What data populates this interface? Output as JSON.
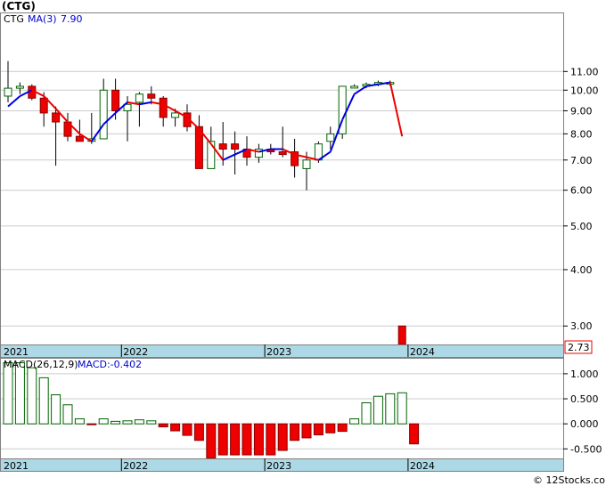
{
  "title": "(CTG)",
  "price_legend": {
    "ticker": "CTG",
    "ma_label": "MA(3)",
    "ma_value": "7.90"
  },
  "macd_legend": {
    "label": "MACD(26,12,9)",
    "value_label": "MACD:-0.402"
  },
  "last_price_label": "2.73",
  "watermark": "© 12Stocks.com",
  "colors": {
    "up_fill": "#ffffff",
    "up_stroke": "#006400",
    "down_fill": "#ee0000",
    "down_stroke": "#880000",
    "ma_up": "#0000dd",
    "ma_down": "#ee0000",
    "axis_band": "#add8e6",
    "grid": "#cccccc"
  },
  "chart_data": [
    {
      "type": "candlestick",
      "scale": "log",
      "ylim": [
        2.73,
        14.8
      ],
      "y_ticks": [
        "3.00",
        "4.00",
        "5.00",
        "6.00",
        "7.00",
        "8.00",
        "9.00",
        "10.00",
        "11.00"
      ],
      "x_labels": [
        {
          "label": "2021",
          "index": 0
        },
        {
          "label": "2022",
          "index": 9.5
        },
        {
          "label": "2023",
          "index": 21.5
        },
        {
          "label": "2024",
          "index": 33.5
        }
      ],
      "candles": [
        {
          "o": 9.7,
          "h": 11.6,
          "l": 9.4,
          "c": 10.1
        },
        {
          "o": 10.1,
          "h": 10.4,
          "l": 9.8,
          "c": 10.2
        },
        {
          "o": 10.2,
          "h": 10.3,
          "l": 9.5,
          "c": 9.6
        },
        {
          "o": 9.6,
          "h": 9.9,
          "l": 8.3,
          "c": 8.9
        },
        {
          "o": 8.9,
          "h": 9.2,
          "l": 6.8,
          "c": 8.5
        },
        {
          "o": 8.5,
          "h": 8.9,
          "l": 7.7,
          "c": 7.9
        },
        {
          "o": 7.9,
          "h": 8.6,
          "l": 7.7,
          "c": 7.7
        },
        {
          "o": 7.7,
          "h": 8.9,
          "l": 7.6,
          "c": 7.8
        },
        {
          "o": 7.8,
          "h": 10.6,
          "l": 7.8,
          "c": 10.0
        },
        {
          "o": 10.0,
          "h": 10.6,
          "l": 8.6,
          "c": 9.0
        },
        {
          "o": 9.0,
          "h": 9.7,
          "l": 7.7,
          "c": 9.3
        },
        {
          "o": 9.4,
          "h": 9.9,
          "l": 8.3,
          "c": 9.8
        },
        {
          "o": 9.8,
          "h": 10.2,
          "l": 9.3,
          "c": 9.6
        },
        {
          "o": 9.6,
          "h": 9.7,
          "l": 8.3,
          "c": 8.7
        },
        {
          "o": 8.7,
          "h": 9.1,
          "l": 8.3,
          "c": 8.9
        },
        {
          "o": 8.9,
          "h": 9.3,
          "l": 8.1,
          "c": 8.3
        },
        {
          "o": 8.3,
          "h": 8.8,
          "l": 7.5,
          "c": 6.7
        },
        {
          "o": 6.7,
          "h": 8.3,
          "l": 6.7,
          "c": 7.7
        },
        {
          "o": 7.6,
          "h": 8.5,
          "l": 6.8,
          "c": 7.4
        },
        {
          "o": 7.6,
          "h": 8.1,
          "l": 6.5,
          "c": 7.4
        },
        {
          "o": 7.4,
          "h": 7.9,
          "l": 6.8,
          "c": 7.1
        },
        {
          "o": 7.1,
          "h": 7.6,
          "l": 6.9,
          "c": 7.4
        },
        {
          "o": 7.4,
          "h": 7.6,
          "l": 7.2,
          "c": 7.3
        },
        {
          "o": 7.3,
          "h": 8.3,
          "l": 7.1,
          "c": 7.2
        },
        {
          "o": 7.3,
          "h": 7.8,
          "l": 6.4,
          "c": 6.8
        },
        {
          "o": 6.7,
          "h": 7.3,
          "l": 6.0,
          "c": 7.0
        },
        {
          "o": 7.0,
          "h": 7.7,
          "l": 6.9,
          "c": 7.6
        },
        {
          "o": 7.7,
          "h": 8.3,
          "l": 7.4,
          "c": 8.0
        },
        {
          "o": 8.0,
          "h": 10.2,
          "l": 7.8,
          "c": 10.2
        },
        {
          "o": 10.2,
          "h": 10.3,
          "l": 10.1,
          "c": 10.2
        },
        {
          "o": 10.3,
          "h": 10.4,
          "l": 10.1,
          "c": 10.3
        },
        {
          "o": 10.3,
          "h": 10.5,
          "l": 10.2,
          "c": 10.4
        },
        {
          "o": 10.4,
          "h": 10.5,
          "l": 10.2,
          "c": 10.4
        },
        {
          "o": 3.0,
          "h": 3.0,
          "l": 2.73,
          "c": 2.73
        }
      ],
      "ma": [
        9.2,
        9.7,
        10.0,
        9.7,
        9.1,
        8.5,
        8.0,
        7.7,
        8.4,
        8.9,
        9.4,
        9.3,
        9.4,
        9.3,
        9.0,
        8.7,
        8.2,
        7.6,
        7.0,
        7.2,
        7.4,
        7.3,
        7.4,
        7.4,
        7.2,
        7.1,
        7.0,
        7.3,
        8.6,
        9.8,
        10.2,
        10.3,
        10.4,
        7.9
      ]
    },
    {
      "type": "bar",
      "name": "MACD(26,12,9)",
      "ylim": [
        -0.69,
        1.3
      ],
      "y_ticks": [
        "1.000",
        "0.500",
        "0.000",
        "-0.500"
      ],
      "x_labels": [
        {
          "label": "2021",
          "index": 0
        },
        {
          "label": "2022",
          "index": 9.5
        },
        {
          "label": "2023",
          "index": 21.5
        },
        {
          "label": "2024",
          "index": 33.5
        }
      ],
      "values": [
        1.22,
        1.22,
        1.12,
        0.92,
        0.58,
        0.38,
        0.1,
        -0.01,
        0.1,
        0.05,
        0.06,
        0.08,
        0.06,
        -0.06,
        -0.14,
        -0.23,
        -0.33,
        -0.68,
        -0.62,
        -0.62,
        -0.62,
        -0.62,
        -0.62,
        -0.53,
        -0.33,
        -0.28,
        -0.22,
        -0.18,
        -0.15,
        0.1,
        0.42,
        0.55,
        0.6,
        0.62,
        -0.4
      ]
    }
  ]
}
